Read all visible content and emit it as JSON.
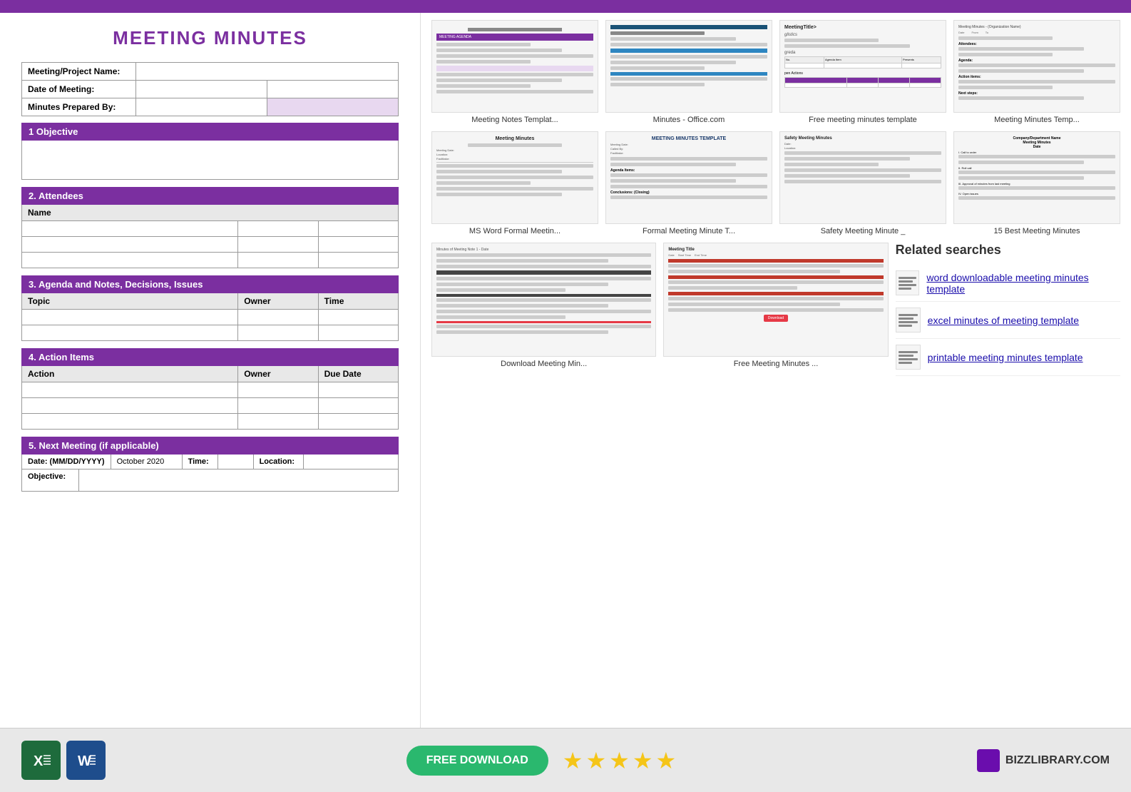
{
  "topBar": {
    "color": "#7b2fa0"
  },
  "form": {
    "title": "MEETING MINUTES",
    "fields": {
      "projectName": {
        "label": "Meeting/Project Name:",
        "value": ""
      },
      "dateOfMeeting": {
        "label": "Date of Meeting:",
        "value": ""
      },
      "preparedBy": {
        "label": "Minutes Prepared By:",
        "value": ""
      }
    },
    "sections": [
      {
        "number": "1",
        "label": "Objective"
      },
      {
        "number": "2",
        "label": "Attendees"
      },
      {
        "number": "3",
        "label": "Agenda and Notes, Decisions, Issues"
      },
      {
        "number": "4",
        "label": "Action Items"
      },
      {
        "number": "5",
        "label": "Next Meeting (if applicable)"
      }
    ],
    "agendaColumns": [
      "Topic",
      "Owner",
      "Time"
    ],
    "actionColumns": [
      "Action",
      "Owner",
      "Due Date"
    ],
    "nextMeeting": {
      "dateLabel": "Date: (MM/DD/YYYY)",
      "dateValue": "October 2020",
      "timeLabel": "Time:",
      "timeValue": "",
      "locationLabel": "Location:",
      "locationValue": ""
    },
    "objectiveLabel": "Objective:"
  },
  "thumbnails": {
    "row1": [
      {
        "label": "Meeting Notes Templat..."
      },
      {
        "label": "Minutes - Office.com"
      },
      {
        "label": "Free meeting minutes template"
      },
      {
        "label": "Meeting Minutes Temp..."
      }
    ],
    "row2": [
      {
        "label": "MS Word Formal Meetin..."
      },
      {
        "label": "Formal Meeting Minute T..."
      },
      {
        "label": "Safety Meeting Minute _"
      },
      {
        "label": "15 Best Meeting Minutes"
      }
    ],
    "row3": [
      {
        "label": "Download Meeting Min..."
      },
      {
        "label": "Free Meeting Minutes ..."
      }
    ]
  },
  "relatedSearches": {
    "title": "Related searches",
    "items": [
      {
        "text": "word downloadable meeting minutes template"
      },
      {
        "text": "excel minutes of meeting template"
      },
      {
        "text": "printable meeting minutes template"
      }
    ]
  },
  "bottomBar": {
    "downloadBtn": "FREE DOWNLOAD",
    "stars": 5,
    "logoText": "BIZZLIBRARY.COM"
  }
}
